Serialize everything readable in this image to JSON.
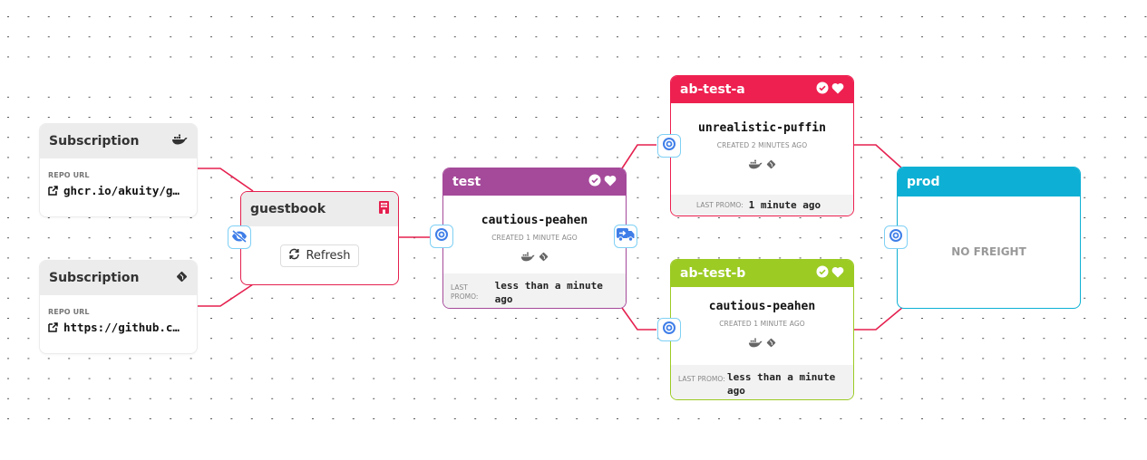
{
  "colors": {
    "edge": "#e5204f",
    "test": "#a54a9a",
    "ab_test_a": "#ee2050",
    "ab_test_b": "#9ccb24",
    "prod": "#0db0d4",
    "port_icon": "#3f7ee8"
  },
  "subscriptions": [
    {
      "title": "Subscription",
      "icon": "docker-icon",
      "repo_label": "REPO URL",
      "repo_url": "ghcr.io/akuity/g…"
    },
    {
      "title": "Subscription",
      "icon": "git-icon",
      "repo_label": "REPO URL",
      "repo_url": "https://github.c…"
    }
  ],
  "warehouse": {
    "title": "guestbook",
    "icon": "warehouse-icon",
    "refresh_label": "Refresh"
  },
  "stages": {
    "test": {
      "title": "test",
      "freight": "cautious-peahen",
      "created": "CREATED 1 MINUTE AGO",
      "promo_label": "LAST PROMO:",
      "promo_value": "less than a minute ago"
    },
    "ab_test_a": {
      "title": "ab-test-a",
      "freight": "unrealistic-puffin",
      "created": "CREATED 2 MINUTES AGO",
      "promo_label": "LAST PROMO:",
      "promo_value": "1 minute ago"
    },
    "ab_test_b": {
      "title": "ab-test-b",
      "freight": "cautious-peahen",
      "created": "CREATED 1 MINUTE AGO",
      "promo_label": "LAST PROMO:",
      "promo_value": "less than a minute ago"
    },
    "prod": {
      "title": "prod",
      "empty_label": "NO FREIGHT"
    }
  }
}
